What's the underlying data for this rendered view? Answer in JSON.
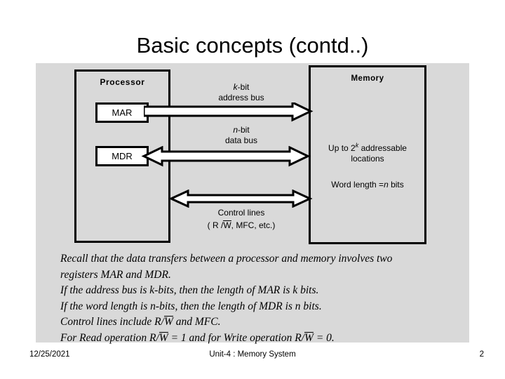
{
  "slide": {
    "title": "Basic concepts (contd..)",
    "background_color": "#ffffff",
    "panel_color": "#d9d9d9"
  },
  "diagram": {
    "processor": {
      "label": "Processor",
      "registers": [
        {
          "name": "MAR",
          "label": "MAR"
        },
        {
          "name": "MDR",
          "label": "MDR"
        }
      ]
    },
    "memory": {
      "label": "Memory",
      "capacity_prefix": "Up to 2",
      "capacity_exponent": "k",
      "capacity_suffix": " addressable",
      "capacity_line2": "locations",
      "word_prefix": "Word length =",
      "word_var": "n",
      "word_suffix": " bits"
    },
    "buses": [
      {
        "name": "address-bus",
        "var": "k",
        "line1_suffix": "-bit",
        "line2": "address bus",
        "direction": "right"
      },
      {
        "name": "data-bus",
        "var": "n",
        "line1_suffix": "-bit",
        "line2": "data bus",
        "direction": "both"
      },
      {
        "name": "control-lines",
        "line1": "Control lines",
        "line2_open": "( R /",
        "line2_overline": "W",
        "line2_rest": ", MFC, etc.)",
        "direction": "both"
      }
    ]
  },
  "body_text": {
    "lines": [
      "Recall that the data transfers between a processor and memory involves two",
      "registers MAR and MDR.",
      "If the address bus is k-bits, then the length of MAR is k bits.",
      "If the word length is n-bits, then the length of MDR is n bits."
    ],
    "line_ctrl_prefix": "Control lines include R/",
    "line_ctrl_overline": "W",
    "line_ctrl_suffix": " and MFC.",
    "line_read_prefix": "For Read operation R/",
    "line_read_overline1": "W",
    "line_read_mid": " = 1 and for Write operation R/",
    "line_read_overline2": "W",
    "line_read_suffix": " = 0."
  },
  "footer": {
    "date": "12/25/2021",
    "center": "Unit-4 : Memory System",
    "page": "2"
  }
}
